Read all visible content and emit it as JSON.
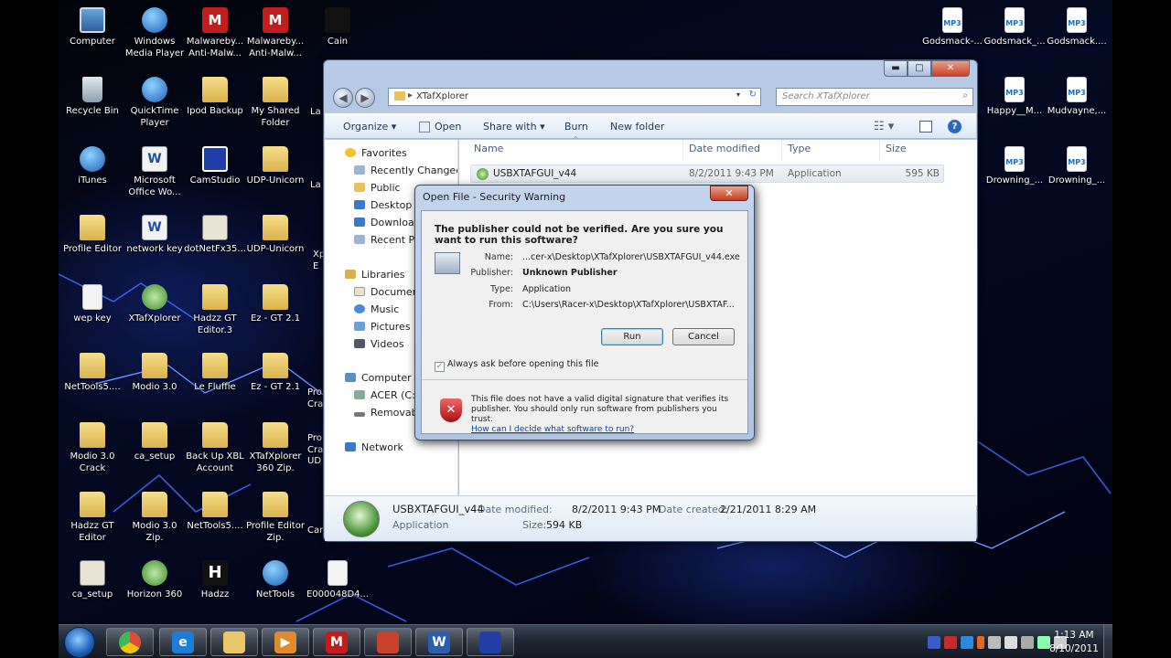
{
  "desktop": {
    "icons": [
      {
        "label": "Computer",
        "kind": "comp"
      },
      {
        "label": "Windows Media Player",
        "kind": "blue"
      },
      {
        "label": "Malwareby... Anti-Malw...",
        "kind": "red",
        "glyph": "M"
      },
      {
        "label": "Malwareby... Anti-Malw...",
        "kind": "red",
        "glyph": "M"
      },
      {
        "label": "Cain",
        "kind": "dark"
      },
      {
        "label": "Recycle Bin",
        "kind": "bin"
      },
      {
        "label": "QuickTime Player",
        "kind": "blue"
      },
      {
        "label": "Ipod Backup",
        "kind": "folder"
      },
      {
        "label": "My Shared Folder",
        "kind": "folder"
      },
      {
        "label": "iTunes",
        "kind": "blue"
      },
      {
        "label": "Microsoft Office Wo...",
        "kind": "word",
        "glyph": "W"
      },
      {
        "label": "CamStudio",
        "kind": "cam"
      },
      {
        "label": "UDP-Unicorn",
        "kind": "folder"
      },
      {
        "label": "Profile Editor",
        "kind": "folder"
      },
      {
        "label": "network key",
        "kind": "word",
        "glyph": "W"
      },
      {
        "label": "dotNetFx35...",
        "kind": "prog"
      },
      {
        "label": "UDP-Unicorn",
        "kind": "folder"
      },
      {
        "label": "wep key",
        "kind": "file"
      },
      {
        "label": "XTafXplorer",
        "kind": "xbox"
      },
      {
        "label": "Hadzz GT Editor.3",
        "kind": "folder"
      },
      {
        "label": "Ez - GT 2.1",
        "kind": "folder"
      },
      {
        "label": "NetTools5....",
        "kind": "folder"
      },
      {
        "label": "Modio 3.0",
        "kind": "folder"
      },
      {
        "label": "Le Fluffie",
        "kind": "folder"
      },
      {
        "label": "Ez - GT 2.1",
        "kind": "folder"
      },
      {
        "label": "Modio 3.0 Crack",
        "kind": "folder"
      },
      {
        "label": "ca_setup",
        "kind": "folder"
      },
      {
        "label": "Back Up XBL Account",
        "kind": "folder"
      },
      {
        "label": "XTafXplorer 360 Zip.",
        "kind": "folder"
      },
      {
        "label": "Hadzz GT Editor",
        "kind": "folder"
      },
      {
        "label": "Modio 3.0 Zip.",
        "kind": "folder"
      },
      {
        "label": "NetTools5....",
        "kind": "folder"
      },
      {
        "label": "Profile Editor Zip.",
        "kind": "folder"
      },
      {
        "label": "ca_setup",
        "kind": "prog"
      },
      {
        "label": "Horizon 360",
        "kind": "xbox"
      },
      {
        "label": "Hadzz",
        "kind": "dark",
        "glyph": "H"
      },
      {
        "label": "NetTools",
        "kind": "blue"
      },
      {
        "label": "E000048D4...",
        "kind": "file"
      },
      {
        "label": "Godsmack-...",
        "kind": "mp3",
        "glyph": "MP3"
      },
      {
        "label": "Godsmack_...",
        "kind": "mp3",
        "glyph": "MP3"
      },
      {
        "label": "Godsmack....",
        "kind": "mp3",
        "glyph": "MP3"
      },
      {
        "label": "Happy__M...",
        "kind": "mp3",
        "glyph": "MP3"
      },
      {
        "label": "Mudvayne,...",
        "kind": "mp3",
        "glyph": "MP3"
      },
      {
        "label": "Drowning_...",
        "kind": "mp3",
        "glyph": "MP3"
      },
      {
        "label": "Drowning_...",
        "kind": "mp3",
        "glyph": "MP3"
      }
    ],
    "partial_labels": [
      "La",
      "La",
      "Xp E",
      "Pro Cra",
      "Pro Cra",
      "UD",
      "Car"
    ]
  },
  "explorer": {
    "window_buttons": {
      "minimize": "▬",
      "maximize": "□",
      "close": "✕"
    },
    "address": "XTafXplorer",
    "search_placeholder": "Search XTafXplorer",
    "toolbar": {
      "organize": "Organize ▾",
      "open": "Open",
      "share": "Share with ▾",
      "burn": "Burn",
      "new_folder": "New folder"
    },
    "nav": {
      "favorites": "Favorites",
      "recent": "Recently Changed",
      "public": "Public",
      "desktop": "Desktop",
      "downloads": "Download",
      "recent_places": "Recent Pla",
      "libraries": "Libraries",
      "documents": "Document",
      "music": "Music",
      "pictures": "Pictures",
      "videos": "Videos",
      "computer": "Computer",
      "acer": "ACER (C:)",
      "removable": "Removabl",
      "network": "Network"
    },
    "columns": {
      "name": "Name",
      "date": "Date modified",
      "type": "Type",
      "size": "Size"
    },
    "file": {
      "name": "USBXTAFGUI_v44",
      "date": "8/2/2011 9:43 PM",
      "type": "Application",
      "size": "595 KB"
    },
    "details": {
      "name": "USBXTAFGUI_v44",
      "type": "Application",
      "modified_label": "Date modified:",
      "modified": "8/2/2011 9:43 PM",
      "created_label": "Date created:",
      "created": "2/21/2011 8:29 AM",
      "size_label": "Size:",
      "size": "594 KB"
    }
  },
  "dialog": {
    "title": "Open File - Security Warning",
    "close": "✕",
    "question": "The publisher could not be verified.  Are you sure you want to run this software?",
    "fields": {
      "name_label": "Name:",
      "name": "...cer-x\\Desktop\\XTafXplorer\\USBXTAFGUI_v44.exe",
      "publisher_label": "Publisher:",
      "publisher": "Unknown Publisher",
      "type_label": "Type:",
      "type": "Application",
      "from_label": "From:",
      "from": "C:\\Users\\Racer-x\\Desktop\\XTafXplorer\\USBXTAF..."
    },
    "run": "Run",
    "cancel": "Cancel",
    "checkbox": "Always ask before opening this file",
    "warning": "This file does not have a valid digital signature that verifies its publisher.  You should only run software from publishers you trust.",
    "link": "How can I decide what software to run?"
  },
  "taskbar": {
    "clock_time": "1:13 AM",
    "clock_date": "8/10/2011",
    "apps": [
      {
        "name": "chrome",
        "glyph": "",
        "color": "#dd4b39"
      },
      {
        "name": "internet-explorer",
        "glyph": "e",
        "color": "#1f7bd8"
      },
      {
        "name": "explorer",
        "glyph": "",
        "color": "#e8c66a"
      },
      {
        "name": "media-player",
        "glyph": "▶",
        "color": "#e08a2e"
      },
      {
        "name": "malwarebytes",
        "glyph": "M",
        "color": "#c21d1d"
      },
      {
        "name": "filezilla",
        "glyph": "",
        "color": "#c8412c"
      },
      {
        "name": "word",
        "glyph": "W",
        "color": "#2b5fad"
      },
      {
        "name": "camstudio",
        "glyph": "",
        "color": "#203ea6"
      }
    ]
  }
}
